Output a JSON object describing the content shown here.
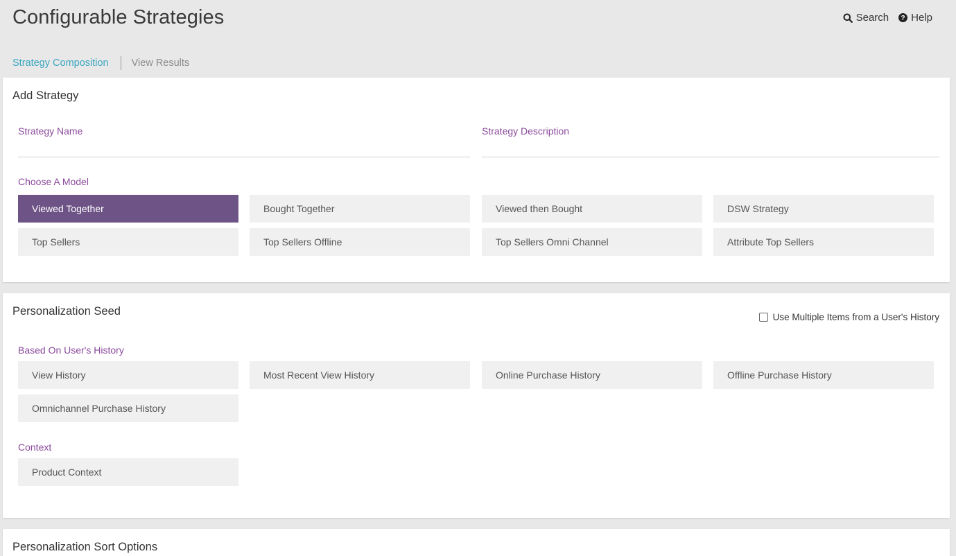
{
  "header": {
    "title": "Configurable Strategies",
    "search_label": "Search",
    "help_label": "Help"
  },
  "tabs": [
    {
      "label": "Strategy Composition",
      "active": true
    },
    {
      "label": "View Results",
      "active": false
    }
  ],
  "add_strategy": {
    "title": "Add Strategy",
    "name_label": "Strategy Name",
    "name_value": "",
    "description_label": "Strategy Description",
    "description_value": "",
    "model_label": "Choose A Model",
    "models": [
      {
        "label": "Viewed Together",
        "selected": true
      },
      {
        "label": "Bought Together",
        "selected": false
      },
      {
        "label": "Viewed then Bought",
        "selected": false
      },
      {
        "label": "DSW Strategy",
        "selected": false
      },
      {
        "label": "Top Sellers",
        "selected": false
      },
      {
        "label": "Top Sellers Offline",
        "selected": false
      },
      {
        "label": "Top Sellers Omni Channel",
        "selected": false
      },
      {
        "label": "Attribute Top Sellers",
        "selected": false
      }
    ]
  },
  "personalization_seed": {
    "title": "Personalization Seed",
    "multi_checkbox_label": "Use Multiple Items from a User's History",
    "multi_checkbox_checked": false,
    "history_label": "Based On User's History",
    "history_options": [
      "View History",
      "Most Recent View History",
      "Online Purchase History",
      "Offline Purchase History",
      "Omnichannel Purchase History"
    ],
    "context_label": "Context",
    "context_options": [
      "Product Context"
    ]
  },
  "sort_options": {
    "title": "Personalization Sort Options"
  },
  "colors": {
    "accent_purple": "#6e5386",
    "label_purple": "#8b4a9c",
    "tab_active": "#3aa7c0"
  }
}
